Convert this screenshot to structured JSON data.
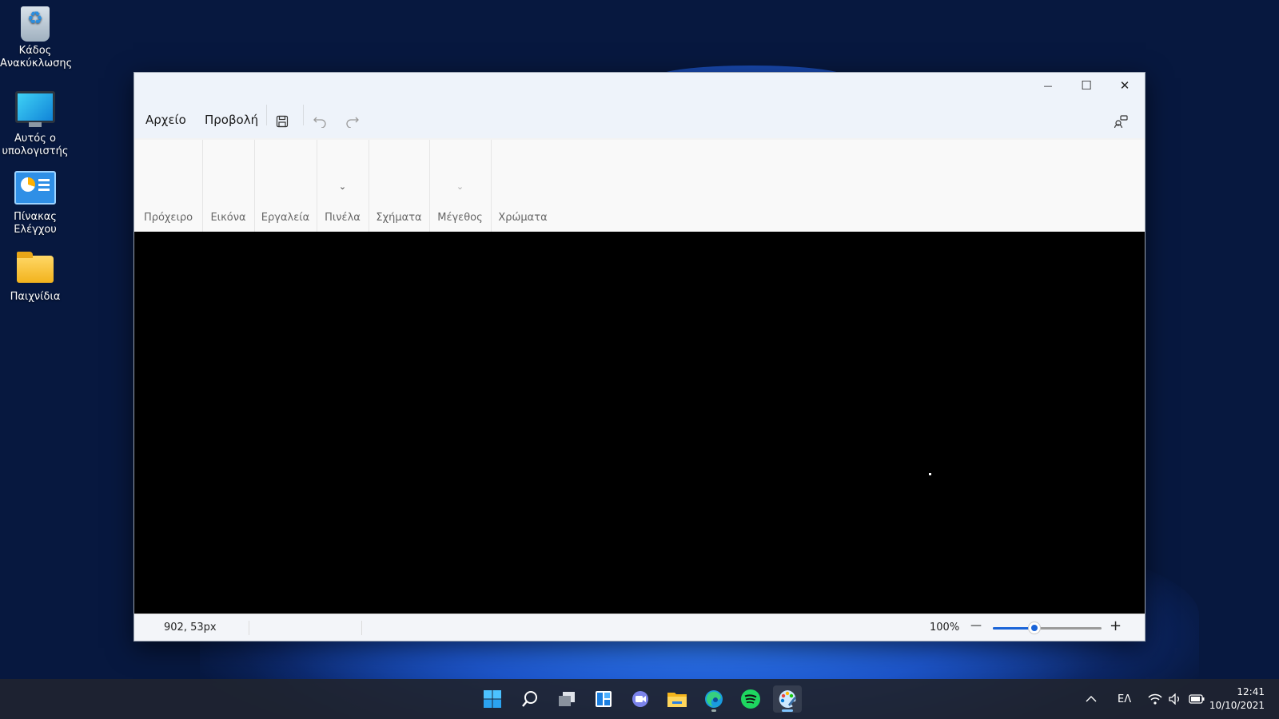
{
  "desktop": {
    "icons": [
      {
        "label_line1": "Κάδος",
        "label_line2": "Ανακύκλωσης",
        "icon": "recycle-bin-icon"
      },
      {
        "label_line1": "Αυτός ο",
        "label_line2": "υπολογιστής",
        "icon": "this-pc-icon"
      },
      {
        "label_line1": "Πίνακας",
        "label_line2": "Ελέγχου",
        "icon": "control-panel-icon"
      },
      {
        "label_line1": "Παιχνίδια",
        "label_line2": "",
        "icon": "folder-icon"
      }
    ]
  },
  "window": {
    "controls": {
      "minimize": "—",
      "maximize": "☐",
      "close": "✕"
    },
    "menu": {
      "file": "Αρχείο",
      "view": "Προβολή"
    },
    "toolbar": {
      "save_icon": "save-icon",
      "undo_icon": "undo-icon",
      "redo_icon": "redo-icon",
      "share_icon": "share-icon"
    },
    "ribbon_groups": [
      {
        "label": "Πρόχειρο"
      },
      {
        "label": "Εικόνα"
      },
      {
        "label": "Εργαλεία"
      },
      {
        "label": "Πινέλα",
        "chevron": "⌄"
      },
      {
        "label": "Σχήματα"
      },
      {
        "label": "Μέγεθος",
        "chevron": "⌄"
      },
      {
        "label": "Χρώματα"
      }
    ],
    "canvas_color": "#000000",
    "status": {
      "cursor_position": "902, 53px",
      "zoom_label": "100%",
      "zoom_out": "—",
      "zoom_in": "+",
      "zoom_level_fraction": 0.38
    }
  },
  "taskbar": {
    "apps": [
      "start-icon",
      "search-icon",
      "task-view-icon",
      "widgets-icon",
      "chat-icon",
      "file-explorer-icon",
      "edge-icon",
      "spotify-icon",
      "paint-icon"
    ],
    "tray": {
      "chevron": "^",
      "language": "ΕΛ",
      "time": "12:41",
      "date": "10/10/2021"
    }
  },
  "colors": {
    "accent": "#1a64d8",
    "taskbar": "#202430"
  }
}
